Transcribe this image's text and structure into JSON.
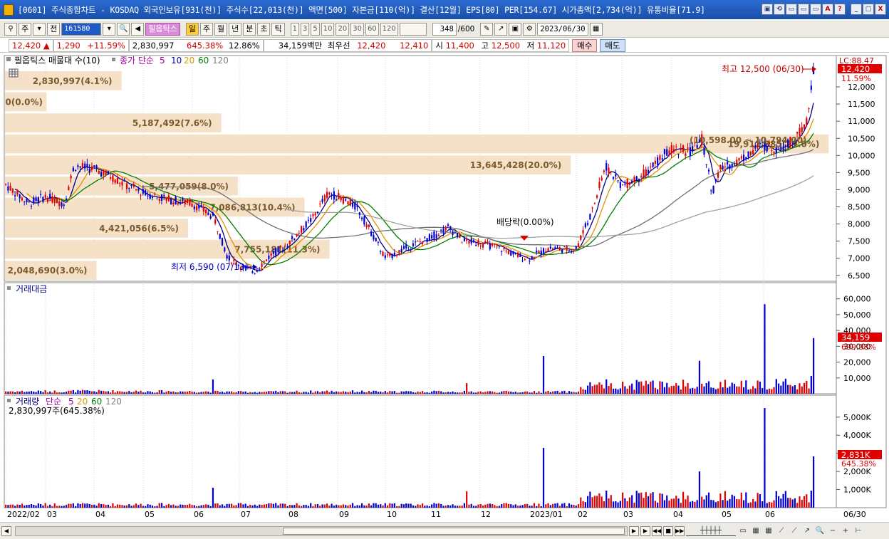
{
  "titlebar": {
    "title": "[0601] 주식종합차트 - KOSDAQ 외국인보유[931(천)] 주식수[22,013(천)] 액면[500] 자본금[110(억)] 결산[12월] EPS[80] PER[154.67] 시가총액[2,734(억)] 유통비율[71.9]",
    "buttons": [
      "▣",
      "⟲",
      "▭",
      "▭",
      "▭",
      "A",
      "?"
    ],
    "window_buttons": [
      "_",
      "□",
      "X"
    ]
  },
  "toolbar": {
    "market": "주",
    "full": "전",
    "code": "161580",
    "indicator": "필옵틱스",
    "periods": [
      "일",
      "주",
      "월",
      "년",
      "분",
      "초",
      "틱"
    ],
    "active_period": "일",
    "multipliers": [
      "1",
      "3",
      "5",
      "10",
      "20",
      "30",
      "60",
      "120"
    ],
    "count": "348",
    "count_total": "/600",
    "date": "2023/06/30"
  },
  "quote": {
    "price": "12,420",
    "arrow": "▲",
    "change": "1,290",
    "change_pct": "+11.59%",
    "volume": "2,830,997",
    "vol_ratio": "645.38%",
    "turnover": "12.86%",
    "value": "34,159백만",
    "best_label": "최우선",
    "best_ask": "12,420",
    "best_bid": "12,410",
    "open_label": "시",
    "open": "11,400",
    "high_label": "고",
    "high": "12,500",
    "low_label": "저",
    "low": "11,120",
    "buy": "매수",
    "sell": "매도"
  },
  "price_panel": {
    "legend_title": "필옵틱스 매물대 수(10)",
    "ma_label": "종가 단순",
    "ma_periods": [
      "5",
      "10",
      "20",
      "60",
      "120"
    ],
    "lc_label": "LC:88.47",
    "current_price_box": "12,420",
    "current_pct_box": "11.59%",
    "high_annot": "최고 12,500 (06/30)",
    "low_annot": "최저 6,590 (07/13)",
    "dividend_annot": "배당락(0.00%)",
    "y_ticks": [
      "12,000",
      "11,500",
      "11,000",
      "10,500",
      "10,000",
      "9,500",
      "9,000",
      "8,500",
      "8,000",
      "7,500",
      "7,000",
      "6,500"
    ],
    "volume_profile": [
      {
        "label": "2,830,997(4.1%)",
        "fraction": 0.14
      },
      {
        "label": "0(0.0%)",
        "fraction": 0.05
      },
      {
        "label": "5,187,492(7.6%)",
        "fraction": 0.26
      },
      {
        "label": "19,911,885(29.0%)",
        "fraction": 0.99
      },
      {
        "label": "13,645,428(20.0%)",
        "fraction": 0.68
      },
      {
        "label": "5,477,059(8.0%)",
        "fraction": 0.28
      },
      {
        "label": "7,086,813(10.4%)",
        "fraction": 0.36
      },
      {
        "label": "4,421,056(6.5%)",
        "fraction": 0.22
      },
      {
        "label": "7,755,181(11.3%)",
        "fraction": 0.39
      },
      {
        "label": "2,048,690(3.0%)",
        "fraction": 0.11
      }
    ],
    "range_text": "(10,598.00 ~ 10,794.00)"
  },
  "value_panel": {
    "title": "거래대금",
    "y_ticks": [
      "60,000",
      "50,000",
      "40,000",
      "30,000",
      "20,000",
      "10,000"
    ],
    "current_box": "34,159",
    "current_pct": "699.98%"
  },
  "volume_panel": {
    "title": "거래량",
    "ma_label": "단순",
    "ma_periods": [
      "5",
      "20",
      "60",
      "120"
    ],
    "value_line": "2,830,997주(645.38%)",
    "y_ticks": [
      "5,000K",
      "4,000K",
      "3,000K",
      "2,000K",
      "1,000K"
    ],
    "current_box": "2,831K",
    "current_pct": "645.38%"
  },
  "x_axis": {
    "labels": [
      "2022/02",
      "03",
      "04",
      "05",
      "06",
      "07",
      "08",
      "09",
      "10",
      "11",
      "12",
      "2023/01",
      "02",
      "03",
      "04",
      "05",
      "06"
    ],
    "end_label": "06/30"
  },
  "colors": {
    "up": "#e00000",
    "down": "#0000d0",
    "ma5": "#000080",
    "ma10": "#e09000",
    "ma20": "#008000",
    "ma60": "#707070",
    "ma120": "#a0a0a0",
    "profile": "#f5e1c8"
  }
}
